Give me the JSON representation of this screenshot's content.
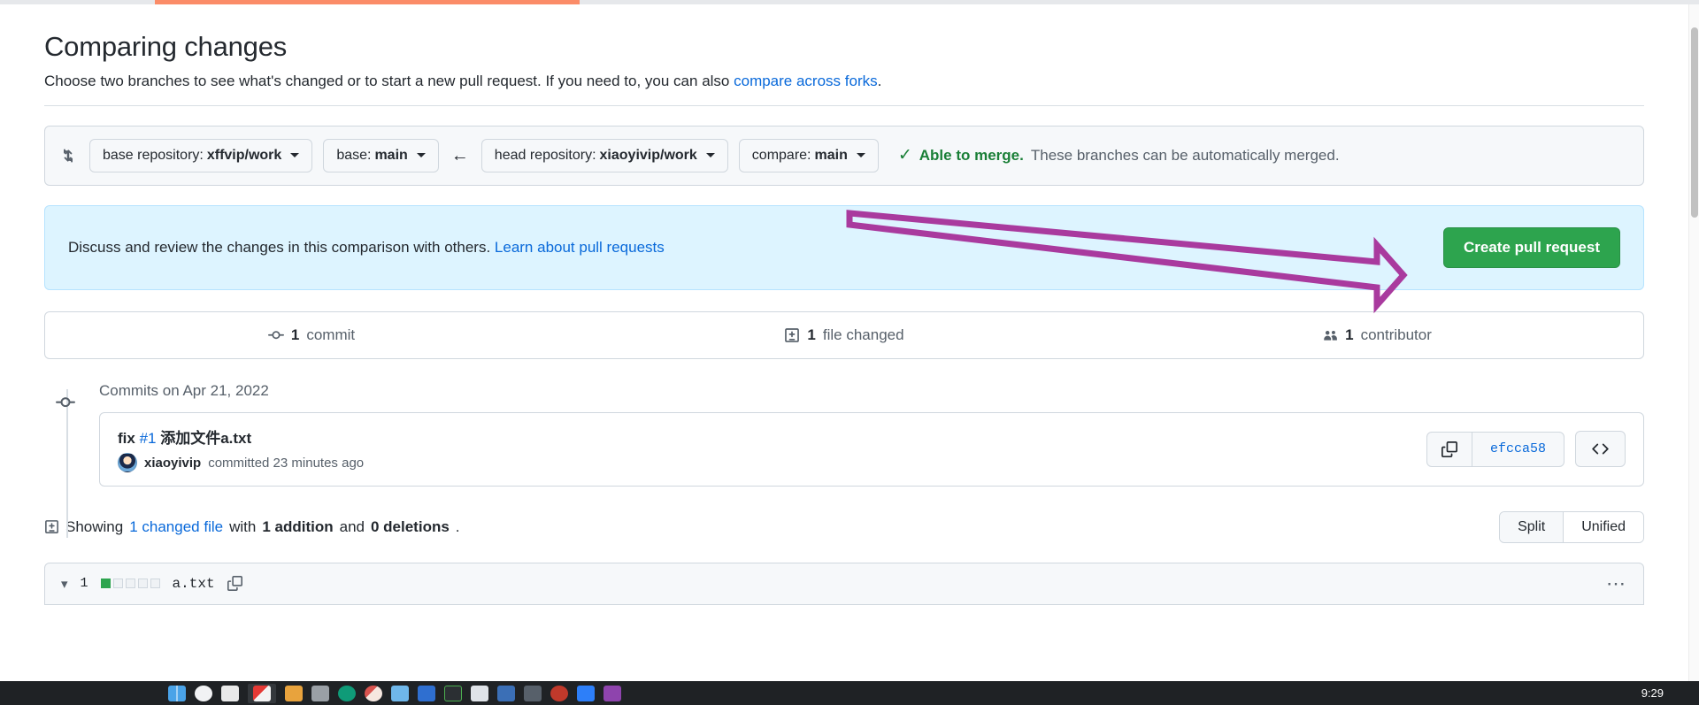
{
  "browser": {
    "loading_bar_color": "#fb8c68"
  },
  "page": {
    "title": "Comparing changes",
    "subtitle_before": "Choose two branches to see what's changed or to start a new pull request. If you need to, you can also ",
    "subtitle_link": "compare across forks",
    "subtitle_after": "."
  },
  "branch_bar": {
    "compare_icon": "git-compare-icon",
    "base_repository": {
      "prefix": "base repository:",
      "value": "xffvip/work",
      "icon": "chevron-down-icon"
    },
    "base_branch": {
      "prefix": "base:",
      "value": "main",
      "icon": "chevron-down-icon"
    },
    "direction_icon": "arrow-left-icon",
    "head_repository": {
      "prefix": "head repository:",
      "value": "xiaoyivip/work",
      "icon": "chevron-down-icon"
    },
    "compare_branch": {
      "prefix": "compare:",
      "value": "main",
      "icon": "chevron-down-icon"
    },
    "merge_status": {
      "icon": "check-icon",
      "strong": "Able to merge.",
      "rest": "These branches can be automatically merged.",
      "color": "#1a7f37"
    }
  },
  "banner": {
    "text": "Discuss and review the changes in this comparison with others.",
    "link": "Learn about pull requests",
    "button": "Create pull request",
    "button_color": "#2da44e",
    "background": "#ddf4ff"
  },
  "stats": [
    {
      "icon": "commit-icon",
      "count": "1",
      "label": "commit",
      "name": "stat-commits"
    },
    {
      "icon": "file-diff-icon",
      "count": "1",
      "label": "file changed",
      "name": "stat-files"
    },
    {
      "icon": "people-icon",
      "count": "1",
      "label": "contributor",
      "name": "stat-contributors"
    }
  ],
  "commits": {
    "date_heading": "Commits on Apr 21, 2022",
    "items": [
      {
        "message_prefix": "fix ",
        "message_ref": "#1",
        "message_rest": " 添加文件a.txt",
        "author": "xiaoyivip",
        "meta": "committed 23 minutes ago",
        "sha": "efcca58",
        "copy_icon": "copy-icon",
        "code_icon": "code-icon"
      }
    ]
  },
  "showing": {
    "icon": "file-diff-icon",
    "prefix": "Showing ",
    "changed_file_link": "1 changed file",
    "middle": " with ",
    "additions": "1 addition",
    "conjunction": " and ",
    "deletions": "0 deletions",
    "suffix": ".",
    "view_modes": [
      "Split",
      "Unified"
    ]
  },
  "diff_file": {
    "chevron_icon": "chevron-down-icon",
    "line_count": "1",
    "diffstat": [
      "add",
      "none",
      "none",
      "none",
      "none"
    ],
    "filename": "a.txt",
    "copy_icon": "copy-path-icon",
    "menu_icon": "kebab-horizontal-icon"
  },
  "annotation": {
    "arrow_color": "#a93a9e",
    "type": "hollow-arrow-pointing-to-create-pull-request"
  },
  "taskbar": {
    "clock": "9:29",
    "background": "#1f2225"
  }
}
